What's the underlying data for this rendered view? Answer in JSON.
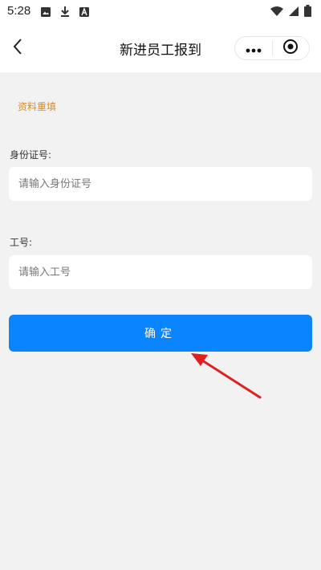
{
  "status_bar": {
    "time": "5:28",
    "left_icons": [
      "image-icon",
      "download-icon",
      "a-badge-icon"
    ],
    "right_icons": [
      "wifi-icon",
      "signal-icon",
      "battery-icon"
    ]
  },
  "nav": {
    "title": "新进员工报到",
    "back_icon": "chevron-left-icon",
    "capsule": {
      "more_icon": "more-dots-icon",
      "close_icon": "target-icon"
    }
  },
  "form": {
    "refill_link": "资料重填",
    "id_card": {
      "label": "身份证号:",
      "placeholder": "请输入身份证号",
      "value": ""
    },
    "employee_no": {
      "label": "工号:",
      "placeholder": "请输入工号",
      "value": ""
    },
    "confirm_label": "确定"
  },
  "colors": {
    "accent": "#0a84ff",
    "refill_link": "#e08a1a",
    "annotation_arrow": "#e02020",
    "page_background": "#f2f2f2"
  }
}
